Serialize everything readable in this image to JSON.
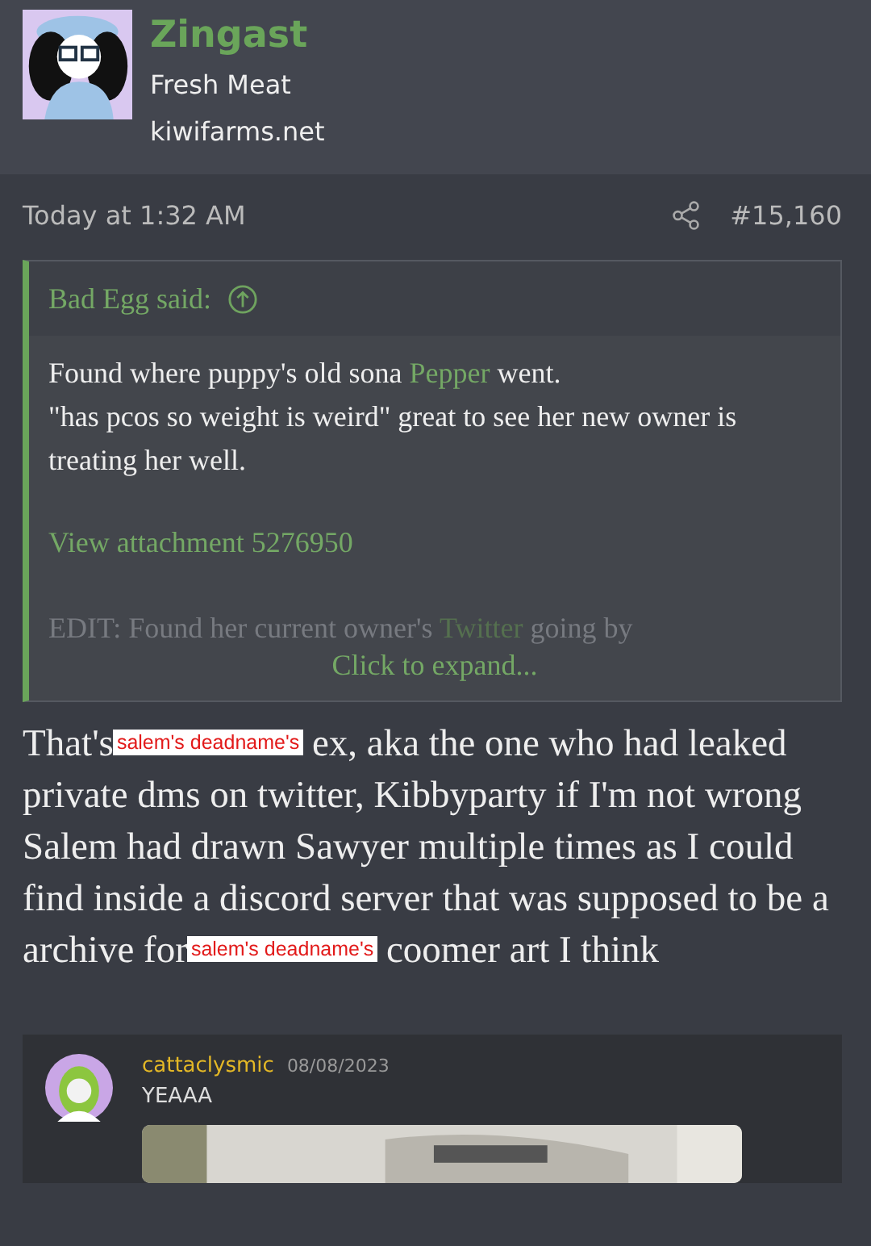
{
  "user": {
    "name": "Zingast",
    "title": "Fresh Meat",
    "site": "kiwifarms.net"
  },
  "post": {
    "time": "Today at 1:32 AM",
    "number": "#15,160"
  },
  "quote": {
    "author": "Bad Egg said:",
    "lines": [
      [
        {
          "kind": "text",
          "text": "Found where puppy's old sona "
        },
        {
          "kind": "link",
          "text": "Pepper"
        },
        {
          "kind": "text",
          "text": " went."
        }
      ],
      [
        {
          "kind": "text",
          "text": "\"has pcos so weight is weird\" great to see her new owner is treating her well."
        }
      ]
    ],
    "attachment": "View attachment 5276950",
    "edit": [
      {
        "kind": "text",
        "text": "EDIT: Found her current owner's "
      },
      {
        "kind": "link",
        "text": "Twitter"
      },
      {
        "kind": "text",
        "text": " going by"
      }
    ],
    "expand": "Click to expand..."
  },
  "body": [
    [
      {
        "kind": "text",
        "text": "That's"
      },
      {
        "kind": "redaction",
        "text": "salem's deadname's"
      },
      {
        "kind": "text",
        "text": " ex, aka the one who had leaked private dms on twitter, Kibbyparty if I'm not wrong"
      }
    ],
    [
      {
        "kind": "text",
        "text": "Salem had drawn Sawyer multiple times as I could find inside a discord server that was supposed to be a archive for"
      },
      {
        "kind": "redaction",
        "text": "salem's deadname's"
      },
      {
        "kind": "text",
        "text": " coomer art I think"
      }
    ]
  ],
  "embed": {
    "author": "cattaclysmic",
    "date": "08/08/2023",
    "message": "YEAAA"
  }
}
